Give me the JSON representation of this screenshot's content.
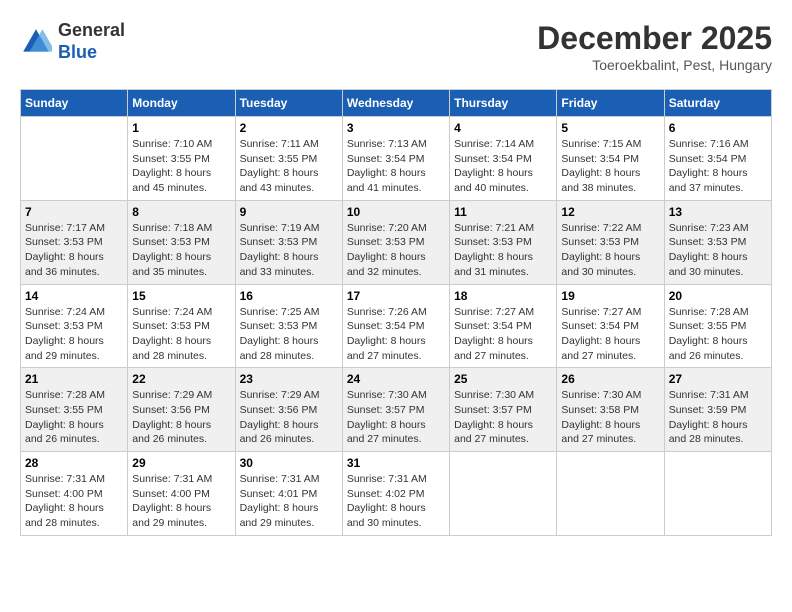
{
  "logo": {
    "general": "General",
    "blue": "Blue"
  },
  "title": "December 2025",
  "subtitle": "Toeroekbalint, Pest, Hungary",
  "days_of_week": [
    "Sunday",
    "Monday",
    "Tuesday",
    "Wednesday",
    "Thursday",
    "Friday",
    "Saturday"
  ],
  "weeks": [
    [
      {
        "day": "",
        "info": ""
      },
      {
        "day": "1",
        "info": "Sunrise: 7:10 AM\nSunset: 3:55 PM\nDaylight: 8 hours\nand 45 minutes."
      },
      {
        "day": "2",
        "info": "Sunrise: 7:11 AM\nSunset: 3:55 PM\nDaylight: 8 hours\nand 43 minutes."
      },
      {
        "day": "3",
        "info": "Sunrise: 7:13 AM\nSunset: 3:54 PM\nDaylight: 8 hours\nand 41 minutes."
      },
      {
        "day": "4",
        "info": "Sunrise: 7:14 AM\nSunset: 3:54 PM\nDaylight: 8 hours\nand 40 minutes."
      },
      {
        "day": "5",
        "info": "Sunrise: 7:15 AM\nSunset: 3:54 PM\nDaylight: 8 hours\nand 38 minutes."
      },
      {
        "day": "6",
        "info": "Sunrise: 7:16 AM\nSunset: 3:54 PM\nDaylight: 8 hours\nand 37 minutes."
      }
    ],
    [
      {
        "day": "7",
        "info": "Sunrise: 7:17 AM\nSunset: 3:53 PM\nDaylight: 8 hours\nand 36 minutes."
      },
      {
        "day": "8",
        "info": "Sunrise: 7:18 AM\nSunset: 3:53 PM\nDaylight: 8 hours\nand 35 minutes."
      },
      {
        "day": "9",
        "info": "Sunrise: 7:19 AM\nSunset: 3:53 PM\nDaylight: 8 hours\nand 33 minutes."
      },
      {
        "day": "10",
        "info": "Sunrise: 7:20 AM\nSunset: 3:53 PM\nDaylight: 8 hours\nand 32 minutes."
      },
      {
        "day": "11",
        "info": "Sunrise: 7:21 AM\nSunset: 3:53 PM\nDaylight: 8 hours\nand 31 minutes."
      },
      {
        "day": "12",
        "info": "Sunrise: 7:22 AM\nSunset: 3:53 PM\nDaylight: 8 hours\nand 30 minutes."
      },
      {
        "day": "13",
        "info": "Sunrise: 7:23 AM\nSunset: 3:53 PM\nDaylight: 8 hours\nand 30 minutes."
      }
    ],
    [
      {
        "day": "14",
        "info": "Sunrise: 7:24 AM\nSunset: 3:53 PM\nDaylight: 8 hours\nand 29 minutes."
      },
      {
        "day": "15",
        "info": "Sunrise: 7:24 AM\nSunset: 3:53 PM\nDaylight: 8 hours\nand 28 minutes."
      },
      {
        "day": "16",
        "info": "Sunrise: 7:25 AM\nSunset: 3:53 PM\nDaylight: 8 hours\nand 28 minutes."
      },
      {
        "day": "17",
        "info": "Sunrise: 7:26 AM\nSunset: 3:54 PM\nDaylight: 8 hours\nand 27 minutes."
      },
      {
        "day": "18",
        "info": "Sunrise: 7:27 AM\nSunset: 3:54 PM\nDaylight: 8 hours\nand 27 minutes."
      },
      {
        "day": "19",
        "info": "Sunrise: 7:27 AM\nSunset: 3:54 PM\nDaylight: 8 hours\nand 27 minutes."
      },
      {
        "day": "20",
        "info": "Sunrise: 7:28 AM\nSunset: 3:55 PM\nDaylight: 8 hours\nand 26 minutes."
      }
    ],
    [
      {
        "day": "21",
        "info": "Sunrise: 7:28 AM\nSunset: 3:55 PM\nDaylight: 8 hours\nand 26 minutes."
      },
      {
        "day": "22",
        "info": "Sunrise: 7:29 AM\nSunset: 3:56 PM\nDaylight: 8 hours\nand 26 minutes."
      },
      {
        "day": "23",
        "info": "Sunrise: 7:29 AM\nSunset: 3:56 PM\nDaylight: 8 hours\nand 26 minutes."
      },
      {
        "day": "24",
        "info": "Sunrise: 7:30 AM\nSunset: 3:57 PM\nDaylight: 8 hours\nand 27 minutes."
      },
      {
        "day": "25",
        "info": "Sunrise: 7:30 AM\nSunset: 3:57 PM\nDaylight: 8 hours\nand 27 minutes."
      },
      {
        "day": "26",
        "info": "Sunrise: 7:30 AM\nSunset: 3:58 PM\nDaylight: 8 hours\nand 27 minutes."
      },
      {
        "day": "27",
        "info": "Sunrise: 7:31 AM\nSunset: 3:59 PM\nDaylight: 8 hours\nand 28 minutes."
      }
    ],
    [
      {
        "day": "28",
        "info": "Sunrise: 7:31 AM\nSunset: 4:00 PM\nDaylight: 8 hours\nand 28 minutes."
      },
      {
        "day": "29",
        "info": "Sunrise: 7:31 AM\nSunset: 4:00 PM\nDaylight: 8 hours\nand 29 minutes."
      },
      {
        "day": "30",
        "info": "Sunrise: 7:31 AM\nSunset: 4:01 PM\nDaylight: 8 hours\nand 29 minutes."
      },
      {
        "day": "31",
        "info": "Sunrise: 7:31 AM\nSunset: 4:02 PM\nDaylight: 8 hours\nand 30 minutes."
      },
      {
        "day": "",
        "info": ""
      },
      {
        "day": "",
        "info": ""
      },
      {
        "day": "",
        "info": ""
      }
    ]
  ]
}
